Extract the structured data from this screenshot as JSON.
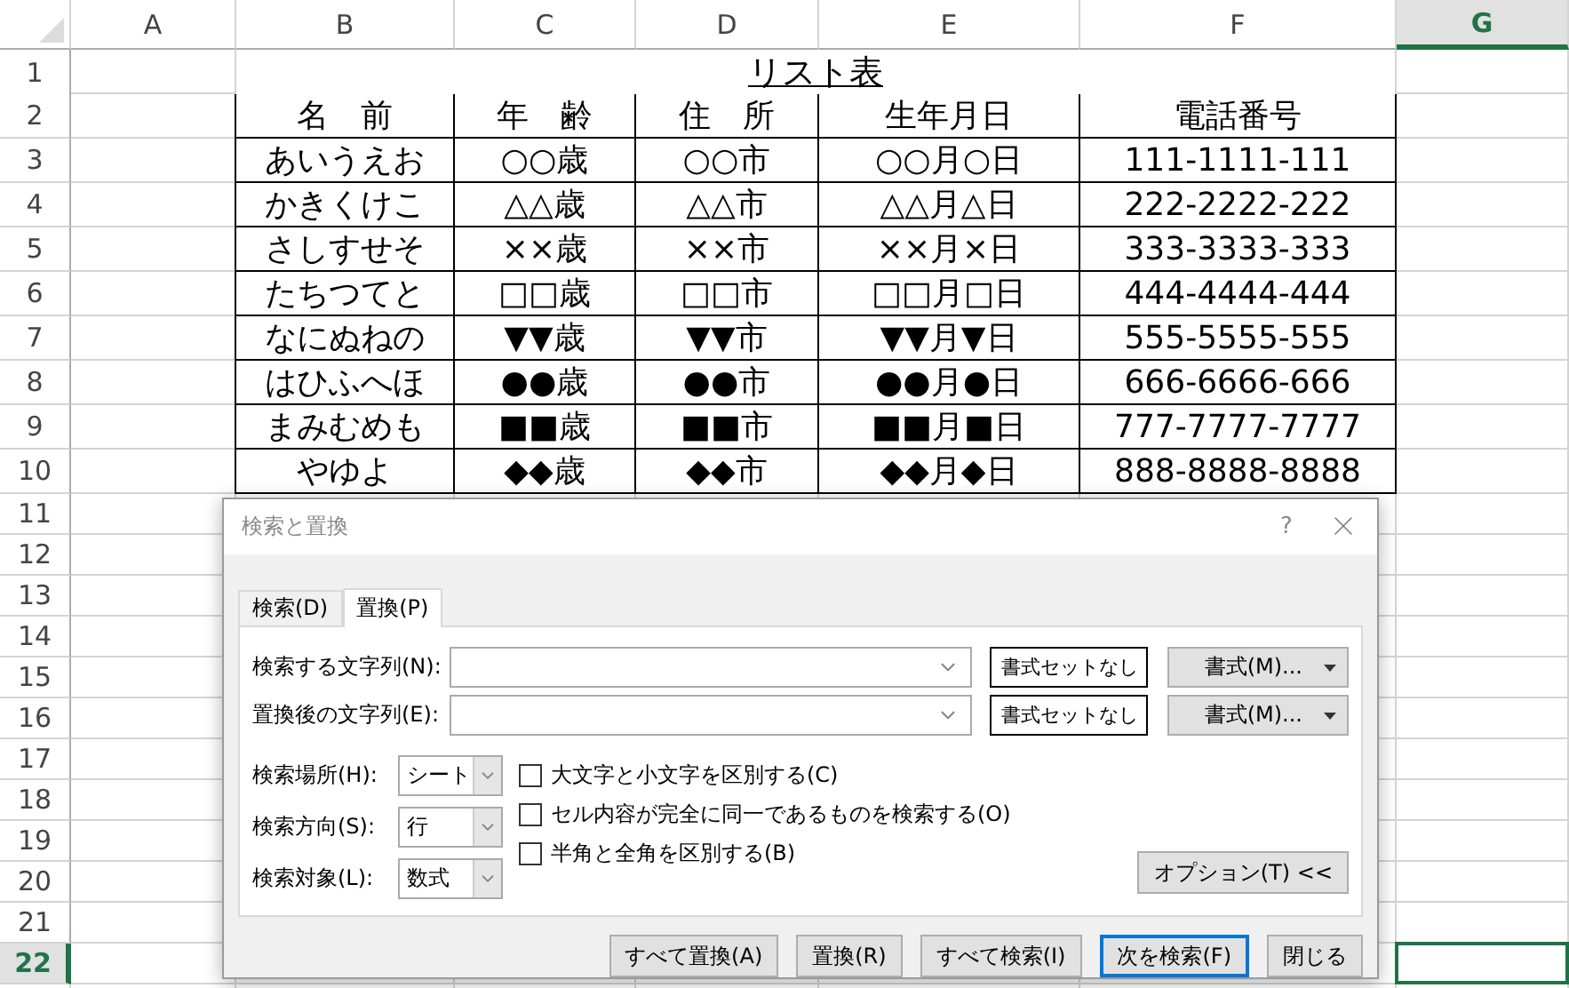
{
  "sheet": {
    "columns": [
      {
        "label": "A",
        "selected": false
      },
      {
        "label": "B",
        "selected": false
      },
      {
        "label": "C",
        "selected": false
      },
      {
        "label": "D",
        "selected": false
      },
      {
        "label": "E",
        "selected": false
      },
      {
        "label": "F",
        "selected": false
      },
      {
        "label": "G",
        "selected": true
      }
    ],
    "rows": [
      {
        "label": "1",
        "selected": false,
        "kind": "title",
        "title": "リスト表"
      },
      {
        "label": "2",
        "selected": false,
        "kind": "header",
        "cells": [
          "名　前",
          "年　齢",
          "住　所",
          "生年月日",
          "電話番号"
        ]
      },
      {
        "label": "3",
        "selected": false,
        "kind": "data",
        "cells": [
          "あいうえお",
          "○○歳",
          "○○市",
          "○○月○日",
          "111-1111-111"
        ]
      },
      {
        "label": "4",
        "selected": false,
        "kind": "data",
        "cells": [
          "かきくけこ",
          "△△歳",
          "△△市",
          "△△月△日",
          "222-2222-222"
        ]
      },
      {
        "label": "5",
        "selected": false,
        "kind": "data",
        "cells": [
          "さしすせそ",
          "××歳",
          "××市",
          "××月×日",
          "333-3333-333"
        ]
      },
      {
        "label": "6",
        "selected": false,
        "kind": "data",
        "cells": [
          "たちつてと",
          "□□歳",
          "□□市",
          "□□月□日",
          "444-4444-444"
        ]
      },
      {
        "label": "7",
        "selected": false,
        "kind": "data",
        "cells": [
          "なにぬねの",
          "▼▼歳",
          "▼▼市",
          "▼▼月▼日",
          "555-5555-555"
        ]
      },
      {
        "label": "8",
        "selected": false,
        "kind": "data",
        "cells": [
          "はひふへほ",
          "●●歳",
          "●●市",
          "●●月●日",
          "666-6666-666"
        ]
      },
      {
        "label": "9",
        "selected": false,
        "kind": "data",
        "cells": [
          "まみむめも",
          "■■歳",
          "■■市",
          "■■月■日",
          "777-7777-7777"
        ]
      },
      {
        "label": "10",
        "selected": false,
        "kind": "data",
        "cells": [
          "やゆよ",
          "◆◆歳",
          "◆◆市",
          "◆◆月◆日",
          "888-8888-8888"
        ]
      },
      {
        "label": "11",
        "selected": false,
        "kind": "empty"
      },
      {
        "label": "12",
        "selected": false,
        "kind": "empty"
      },
      {
        "label": "13",
        "selected": false,
        "kind": "empty"
      },
      {
        "label": "14",
        "selected": false,
        "kind": "empty"
      },
      {
        "label": "15",
        "selected": false,
        "kind": "empty"
      },
      {
        "label": "16",
        "selected": false,
        "kind": "empty"
      },
      {
        "label": "17",
        "selected": false,
        "kind": "empty"
      },
      {
        "label": "18",
        "selected": false,
        "kind": "empty"
      },
      {
        "label": "19",
        "selected": false,
        "kind": "empty"
      },
      {
        "label": "20",
        "selected": false,
        "kind": "empty"
      },
      {
        "label": "21",
        "selected": false,
        "kind": "empty"
      },
      {
        "label": "22",
        "selected": true,
        "kind": "empty"
      }
    ]
  },
  "dialog": {
    "title": "検索と置換",
    "help": "?",
    "tabs": [
      {
        "label": "検索(D)",
        "selected": false
      },
      {
        "label": "置換(P)",
        "selected": true
      }
    ],
    "fields": [
      {
        "label": "検索する文字列(N):",
        "format_preview": "書式セットなし",
        "format_button": "書式(M)..."
      },
      {
        "label": "置換後の文字列(E):",
        "format_preview": "書式セットなし",
        "format_button": "書式(M)..."
      }
    ],
    "selects": [
      {
        "label": "検索場所(H):",
        "value": "シート"
      },
      {
        "label": "検索方向(S):",
        "value": "行"
      },
      {
        "label": "検索対象(L):",
        "value": "数式"
      }
    ],
    "checkboxes": [
      {
        "label": "大文字と小文字を区別する(C)",
        "checked": false
      },
      {
        "label": "セル内容が完全に同一であるものを検索する(O)",
        "checked": false
      },
      {
        "label": "半角と全角を区別する(B)",
        "checked": false
      }
    ],
    "options_button": "オプション(T) <<",
    "buttons": [
      {
        "label": "すべて置換(A)",
        "default": false
      },
      {
        "label": "置換(R)",
        "default": false
      },
      {
        "label": "すべて検索(I)",
        "default": false
      },
      {
        "label": "次を検索(F)",
        "default": true
      },
      {
        "label": "閉じる",
        "default": false
      }
    ]
  }
}
